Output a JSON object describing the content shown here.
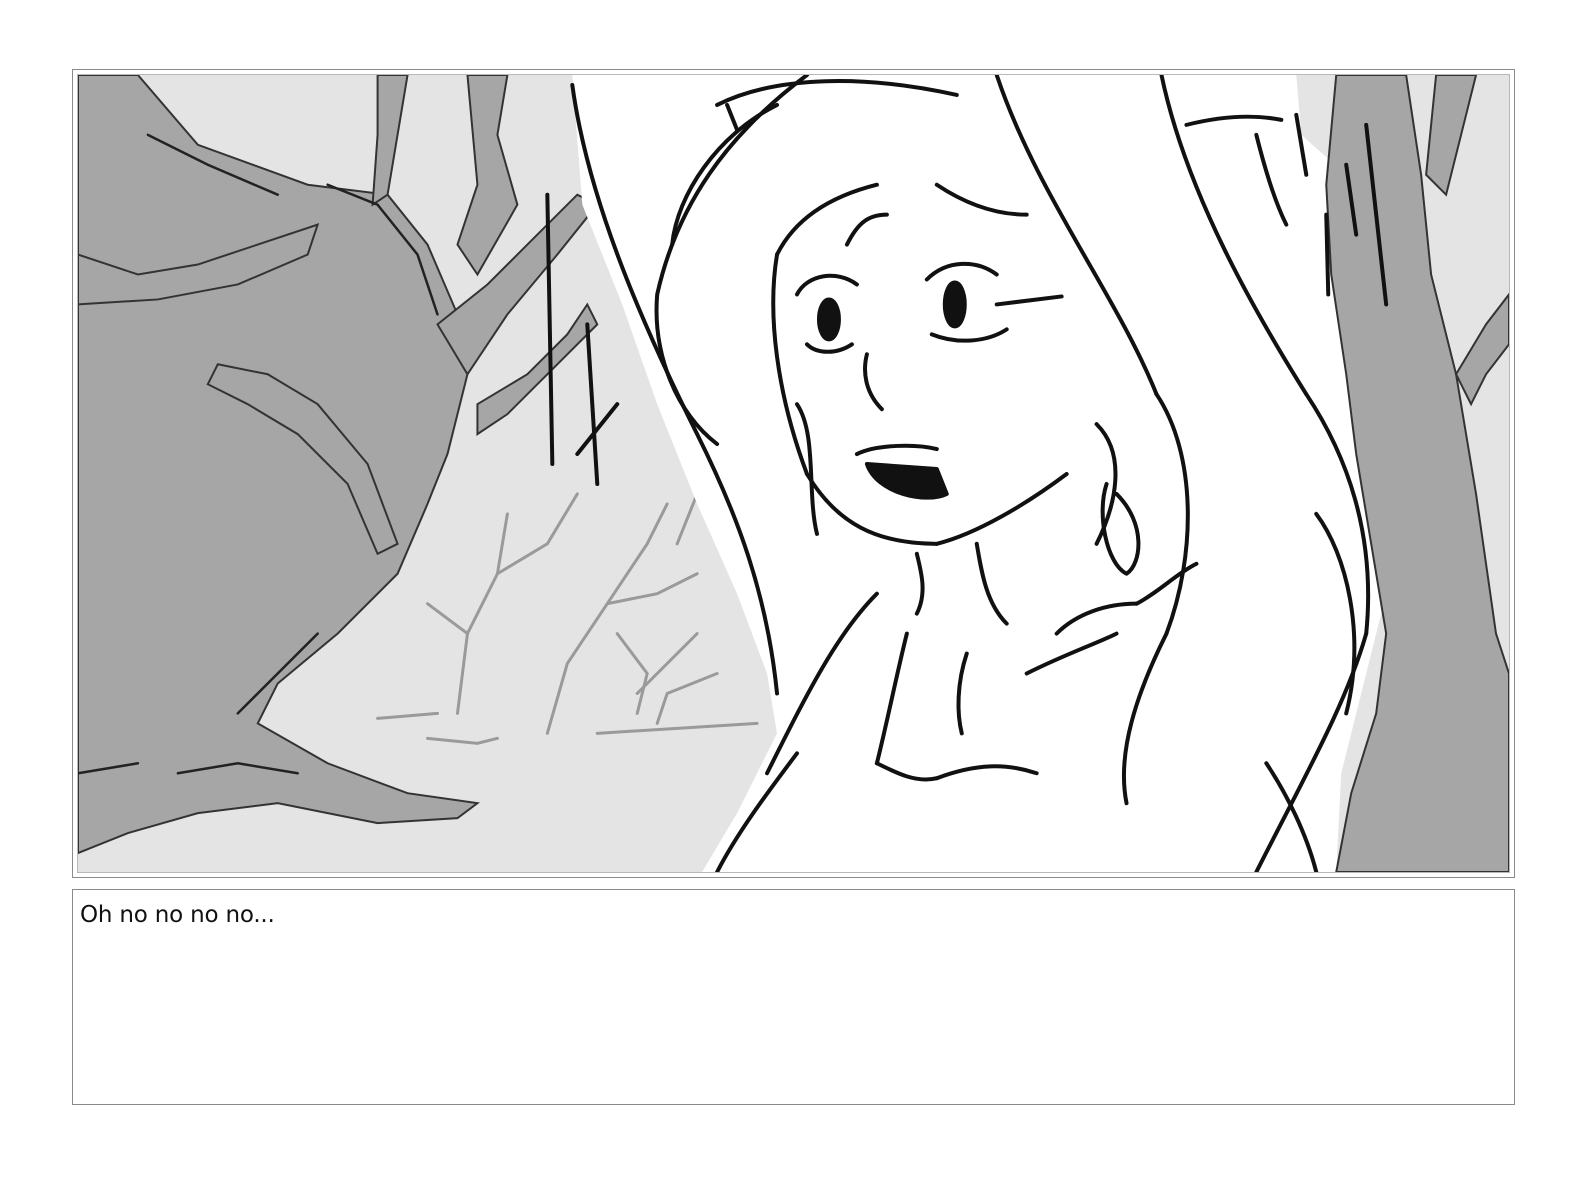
{
  "panel": {
    "image_name": "storyboard-panel",
    "subject": "woman-in-forest-drawing"
  },
  "caption": {
    "text": "Oh no no no no..."
  },
  "colors": {
    "background_tone": "#e4e4e4",
    "tree_tone": "#a9a9a9",
    "line_tone": "#111111",
    "frame_border": "#8a8a8a"
  }
}
